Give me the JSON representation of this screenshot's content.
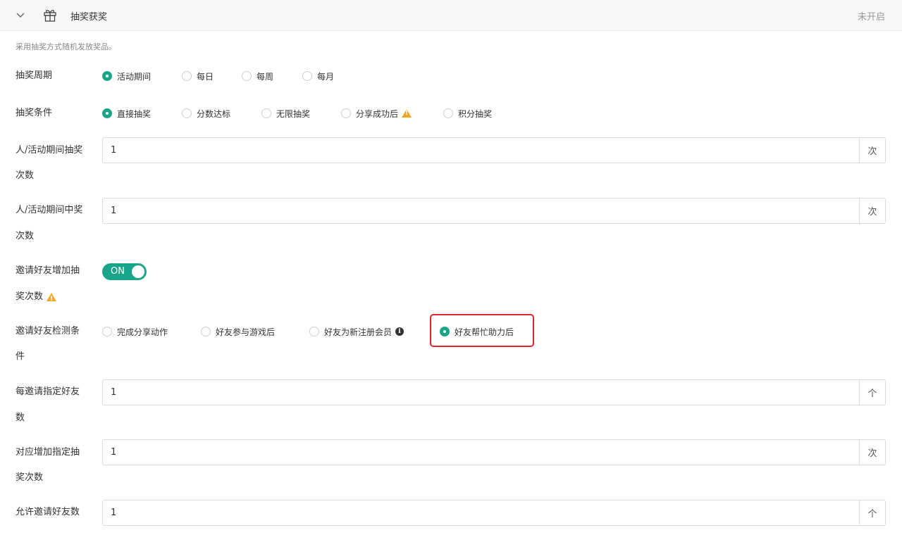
{
  "header": {
    "title": "抽奖获奖",
    "status": "未开启",
    "chevron_icon": "chevron-down-icon",
    "gift_icon": "gift-icon"
  },
  "description": "采用抽奖方式随机发放奖品。",
  "period": {
    "label": "抽奖周期",
    "options": [
      "活动期间",
      "每日",
      "每周",
      "每月"
    ],
    "selected": "活动期间"
  },
  "condition": {
    "label": "抽奖条件",
    "options": [
      "直接抽奖",
      "分数达标",
      "无限抽奖",
      "分享成功后",
      "积分抽奖"
    ],
    "selected": "直接抽奖"
  },
  "draw_times": {
    "label_line1": "人/活动期间抽奖",
    "label_line2": "次数",
    "value": "1",
    "unit": "次"
  },
  "win_times": {
    "label_line1": "人/活动期间中奖",
    "label_line2": "次数",
    "value": "1",
    "unit": "次"
  },
  "invite_bonus": {
    "label_line1": "邀请好友增加抽",
    "label_line2": "奖次数",
    "toggle_text": "ON",
    "enabled": true
  },
  "invite_detect": {
    "label_line1": "邀请好友检测条",
    "label_line2": "件",
    "options": [
      "完成分享动作",
      "好友参与游戏后",
      "好友为新注册会员",
      "好友帮忙助力后"
    ],
    "selected": "好友帮忙助力后"
  },
  "per_invite": {
    "label_line1": "每邀请指定好友",
    "label_line2": "数",
    "value": "1",
    "unit": "个"
  },
  "add_draws": {
    "label_line1": "对应增加指定抽",
    "label_line2": "奖次数",
    "value": "1",
    "unit": "次"
  },
  "allow_invites": {
    "label": "允许邀请好友数",
    "value": "1",
    "unit": "个"
  },
  "colors": {
    "accent": "#1aa58a",
    "warning": "#f5a623",
    "highlight": "#e0262d"
  }
}
